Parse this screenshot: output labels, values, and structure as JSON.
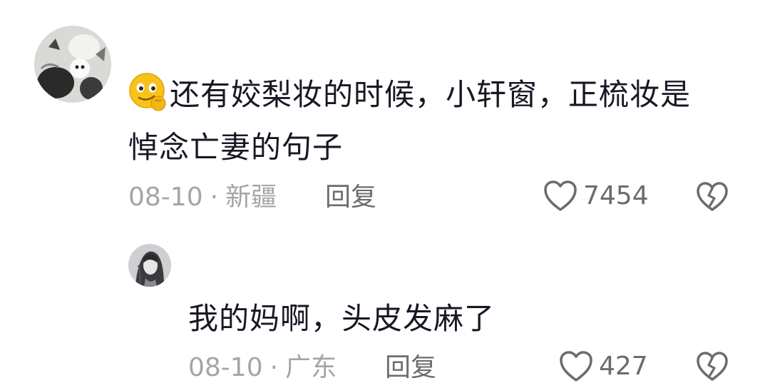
{
  "comments": [
    {
      "avatar_icon": "cat-avatar",
      "emoji_icon": "thinking-face-emoji",
      "text_line1": "还有姣梨妆的时候，小轩窗，正梳妆是",
      "text_line2": "悼念亡妻的句子",
      "date": "08-10",
      "location": "新疆",
      "reply_label": "回复",
      "like_count": "7454"
    },
    {
      "avatar_icon": "portrait-avatar",
      "text": "我的妈啊，头皮发麻了",
      "date": "08-10",
      "location": "广东",
      "reply_label": "回复",
      "like_count": "427"
    }
  ],
  "separator": "·",
  "colors": {
    "text": "#161823",
    "meta": "#a5a5a8",
    "action": "#6b6b70"
  }
}
